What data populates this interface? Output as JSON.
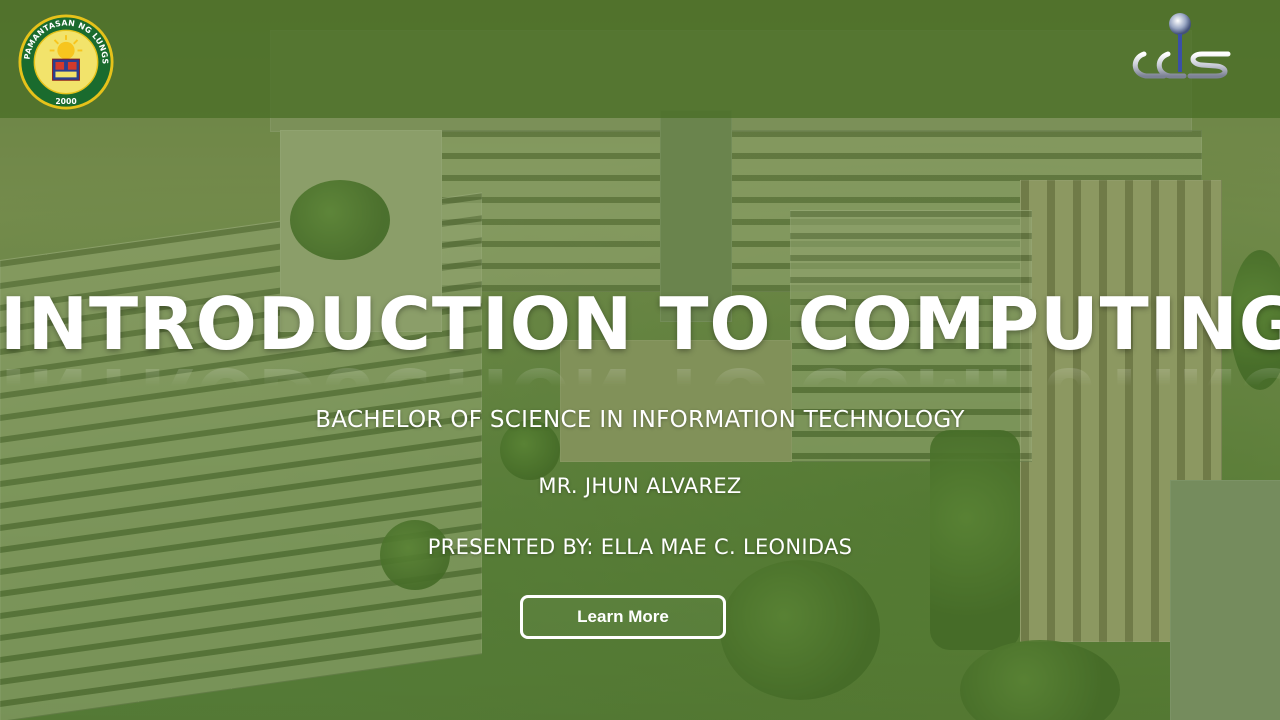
{
  "header": {
    "seal_text": "PAMANTASAN NG LUNGSOD NG PASIG",
    "seal_year": "2000",
    "seal_icon": "school-seal-icon",
    "logo_icon": "ccs-logo-icon"
  },
  "hero": {
    "title": "INTRODUCTION TO COMPUTING",
    "degree": "BACHELOR OF SCIENCE IN INFORMATION TECHNOLOGY",
    "teacher": "MR. JHUN ALVAREZ",
    "presenter": "PRESENTED BY: ELLA MAE C. LEONIDAS",
    "cta_label": "Learn More"
  },
  "colors": {
    "header_bar": "#4a6e26",
    "overlay": "#507828",
    "text": "#ffffff"
  }
}
